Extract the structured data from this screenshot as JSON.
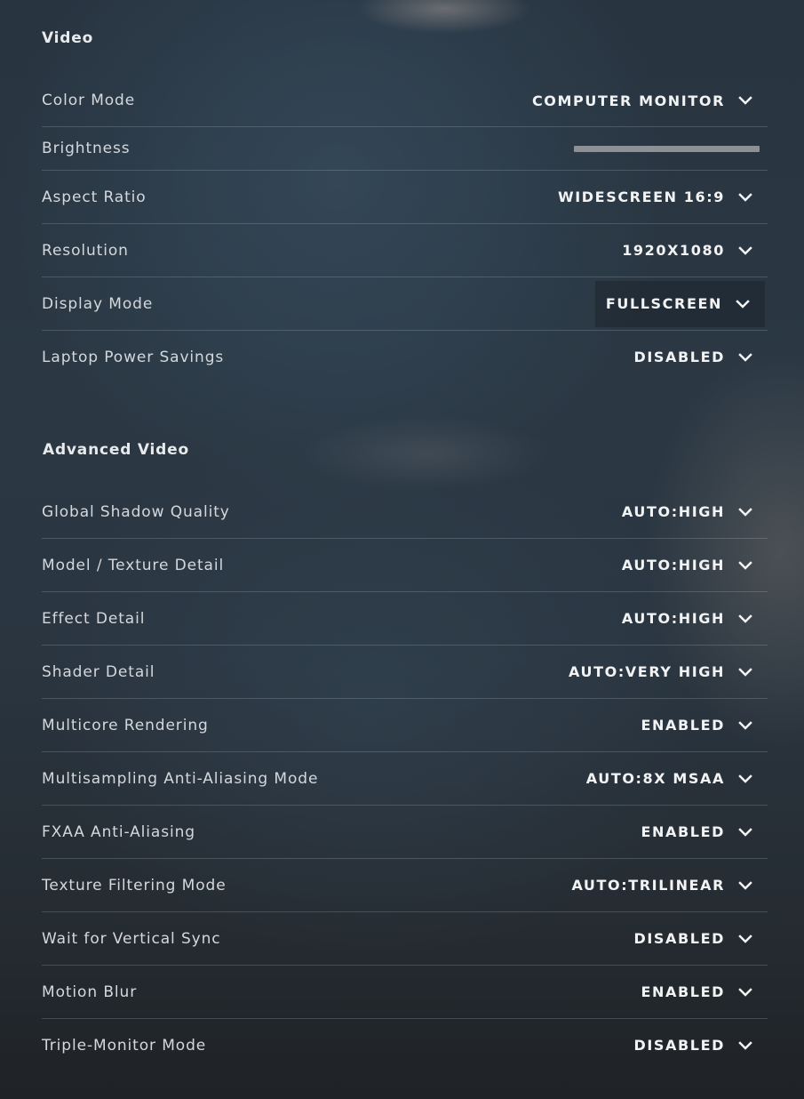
{
  "video": {
    "title": "Video",
    "color_mode": {
      "label": "Color Mode",
      "value": "COMPUTER MONITOR"
    },
    "brightness": {
      "label": "Brightness",
      "level": 1.0
    },
    "aspect_ratio": {
      "label": "Aspect Ratio",
      "value": "WIDESCREEN 16:9"
    },
    "resolution": {
      "label": "Resolution",
      "value": "1920X1080"
    },
    "display_mode": {
      "label": "Display Mode",
      "value": "FULLSCREEN"
    },
    "laptop_power": {
      "label": "Laptop Power Savings",
      "value": "DISABLED"
    }
  },
  "advanced": {
    "title": "Advanced Video",
    "items": [
      {
        "label": "Global Shadow Quality",
        "value": "AUTO:HIGH"
      },
      {
        "label": "Model / Texture Detail",
        "value": "AUTO:HIGH"
      },
      {
        "label": "Effect Detail",
        "value": "AUTO:HIGH"
      },
      {
        "label": "Shader Detail",
        "value": "AUTO:VERY HIGH"
      },
      {
        "label": "Multicore Rendering",
        "value": "ENABLED"
      },
      {
        "label": "Multisampling Anti-Aliasing Mode",
        "value": "AUTO:8X MSAA"
      },
      {
        "label": "FXAA Anti-Aliasing",
        "value": "ENABLED"
      },
      {
        "label": "Texture Filtering Mode",
        "value": "AUTO:TRILINEAR"
      },
      {
        "label": "Wait for Vertical Sync",
        "value": "DISABLED"
      },
      {
        "label": "Motion Blur",
        "value": "ENABLED"
      },
      {
        "label": "Triple-Monitor Mode",
        "value": "DISABLED"
      }
    ]
  },
  "colors": {
    "background": "#2a3540",
    "text": "#d4d8dc",
    "value_text": "#f2f3f4",
    "divider": "#4a525a",
    "slider": "#8c9196"
  },
  "icons": {
    "dropdown": "chevron-down-icon"
  }
}
